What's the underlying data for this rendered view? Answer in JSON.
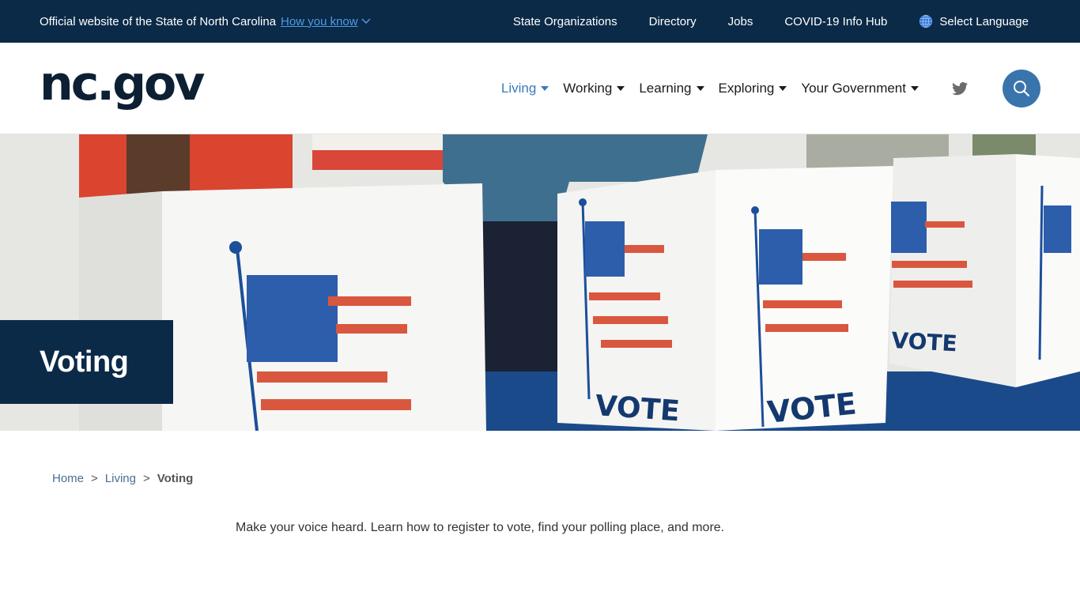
{
  "topbar": {
    "official_text": "Official website of the State of North Carolina",
    "how_you_know": "How you know",
    "links": [
      "State Organizations",
      "Directory",
      "Jobs",
      "COVID-19 Info Hub"
    ],
    "language": "Select Language"
  },
  "header": {
    "logo": "nc.gov",
    "nav": [
      {
        "label": "Living",
        "active": true
      },
      {
        "label": "Working",
        "active": false
      },
      {
        "label": "Learning",
        "active": false
      },
      {
        "label": "Exploring",
        "active": false
      },
      {
        "label": "Your Government",
        "active": false
      }
    ],
    "social_icon": "twitter-icon",
    "search_icon": "search-icon"
  },
  "hero": {
    "title": "Voting",
    "image_alt": "Voting booths with American flags and VOTE text",
    "booth_text": "VOTE"
  },
  "breadcrumb": {
    "items": [
      "Home",
      "Living"
    ],
    "separator": ">",
    "current": "Voting"
  },
  "intro": "Make your voice heard. Learn how to register to vote, find your polling place, and more.",
  "colors": {
    "navy": "#0b2a47",
    "accent_blue": "#3a74ad",
    "link_blue": "#4c9ce8"
  }
}
